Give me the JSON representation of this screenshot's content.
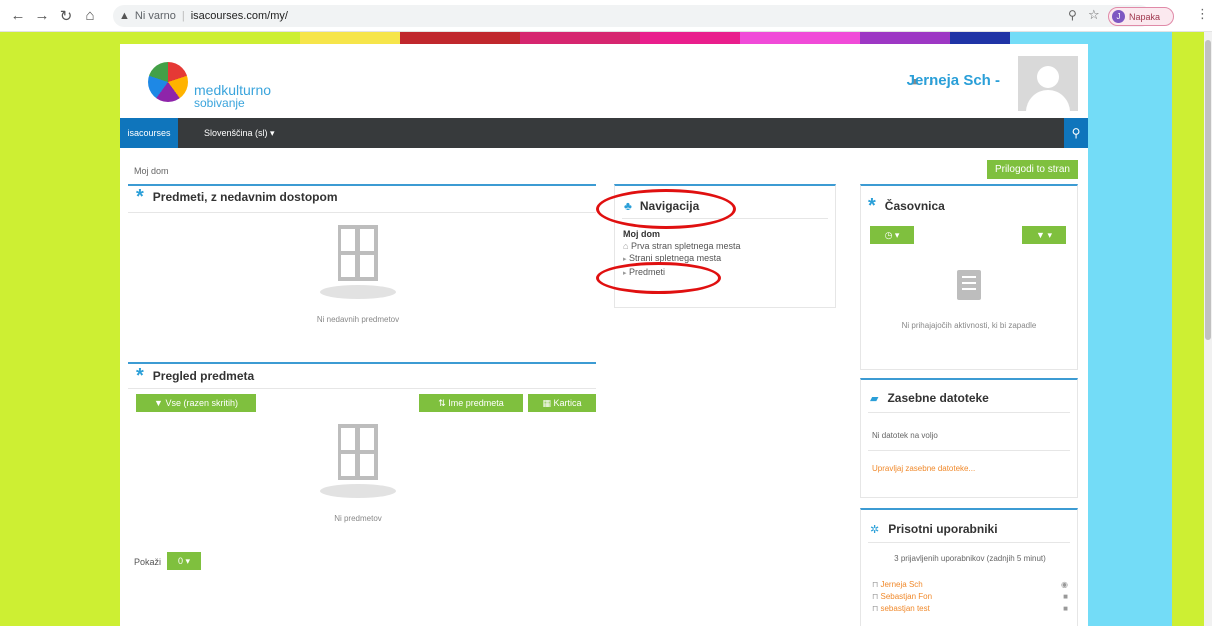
{
  "browser": {
    "not_secure": "Ni varno",
    "url": "isacourses.com/my/",
    "profile_label": "Napaka",
    "profile_initial": "J"
  },
  "stripe_colors": [
    "#cdef33",
    "#cdef33",
    "#f6e54a",
    "#c0272d",
    "#d6266f",
    "#e91e8c",
    "#f04bd8",
    "#9d37c4",
    "#2034a6",
    "#73dcf7"
  ],
  "header": {
    "logo_line1": "medkulturno",
    "logo_line2": "sobivanje",
    "user_name": "Jerneja Sch -"
  },
  "navbar": {
    "brand": "isacourses",
    "language": "Slovenščina (sl) ▾"
  },
  "breadcrumb": "Moj dom",
  "customize_button": "Prilogodi to stran",
  "recent_courses": {
    "title": "Predmeti, z nedavnim dostopom",
    "empty": "Ni nedavnih predmetov"
  },
  "course_overview": {
    "title": "Pregled predmeta",
    "filter_button": "▼ Vse (razen skritih)",
    "sort_button": "⇅ Ime predmeta",
    "view_button": "▦ Kartica",
    "empty": "Ni predmetov",
    "show_label": "Pokaži",
    "show_button": "0 ▾"
  },
  "navigation": {
    "title": "Navigacija",
    "home": "Moj dom",
    "items": [
      "Prva stran spletnega mesta",
      "Strani spletnega mesta",
      "Predmeti"
    ]
  },
  "timeline": {
    "title": "Časovnica",
    "empty": "Ni prihajajočih aktivnosti, ki bi zapadle"
  },
  "private_files": {
    "title": "Zasebne datoteke",
    "empty": "Ni datotek na voljo",
    "manage_link": "Upravljaj zasebne datoteke..."
  },
  "online_users": {
    "title": "Prisotni uporabniki",
    "summary": "3 prijavljenih uporabnikov (zadnjih 5 minut)",
    "users": [
      "Jerneja Sch",
      "Sebastjan Fon",
      "sebastjan test"
    ]
  }
}
